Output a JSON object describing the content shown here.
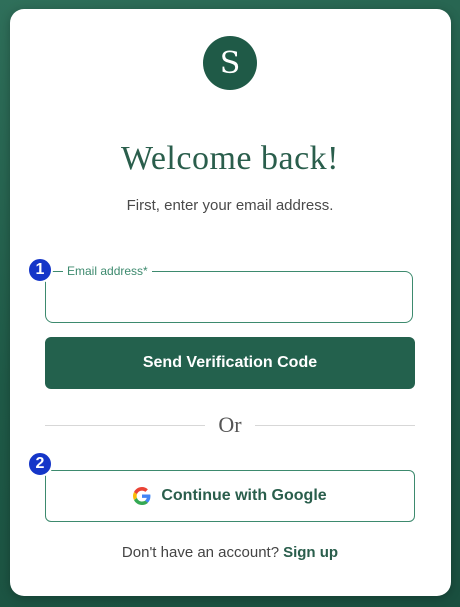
{
  "logo": {
    "letter": "S"
  },
  "header": {
    "title": "Welcome back!",
    "subtitle": "First, enter your email address."
  },
  "email_field": {
    "label": "Email address*",
    "value": "",
    "placeholder": ""
  },
  "primary_button": {
    "label": "Send Verification Code"
  },
  "divider": {
    "label": "Or"
  },
  "google_button": {
    "label": "Continue with Google",
    "icon": "google-icon"
  },
  "signup": {
    "prompt": "Don't have an account?",
    "link_label": "Sign up"
  },
  "markers": [
    {
      "label": "1"
    },
    {
      "label": "2"
    }
  ],
  "colors": {
    "brand": "#23614d",
    "accent": "#3d8a6e",
    "marker": "#1536c8"
  }
}
